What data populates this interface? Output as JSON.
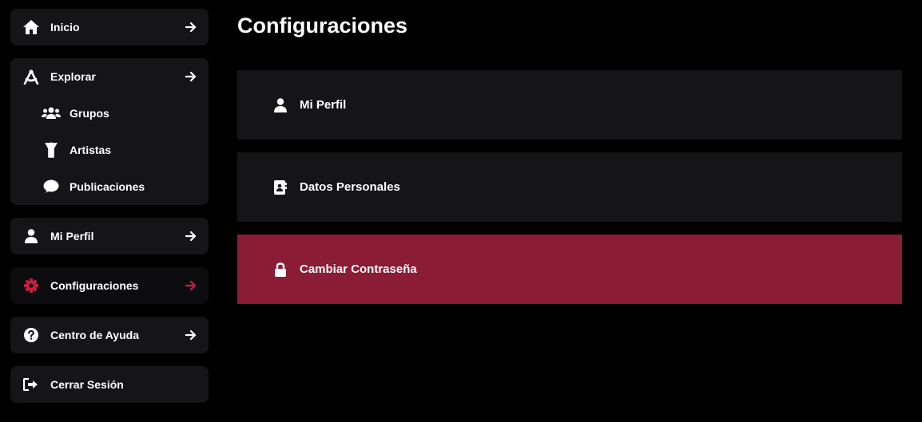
{
  "colors": {
    "background": "#000000",
    "card": "#151517",
    "active_card": "#0c0c0e",
    "accent": "#c8203f",
    "selected_option": "#8a1c35",
    "text": "#ffffff"
  },
  "sidebar": {
    "home": {
      "label": "Inicio",
      "icon": "home-icon"
    },
    "explore": {
      "label": "Explorar",
      "icon": "compass-icon",
      "children": [
        {
          "label": "Grupos",
          "icon": "users-icon"
        },
        {
          "label": "Artistas",
          "icon": "person-arms-up-icon"
        },
        {
          "label": "Publicaciones",
          "icon": "comment-icon"
        }
      ]
    },
    "profile": {
      "label": "Mi Perfil",
      "icon": "user-icon"
    },
    "settings": {
      "label": "Configuraciones",
      "icon": "gear-icon",
      "active": true
    },
    "help": {
      "label": "Centro de Ayuda",
      "icon": "question-circle-icon"
    },
    "logout": {
      "label": "Cerrar Sesión",
      "icon": "sign-out-icon"
    }
  },
  "main": {
    "title": "Configuraciones",
    "options": [
      {
        "label": "Mi Perfil",
        "icon": "user-icon",
        "selected": false
      },
      {
        "label": "Datos Personales",
        "icon": "address-book-icon",
        "selected": false
      },
      {
        "label": "Cambiar Contraseña",
        "icon": "lock-icon",
        "selected": true
      }
    ]
  }
}
